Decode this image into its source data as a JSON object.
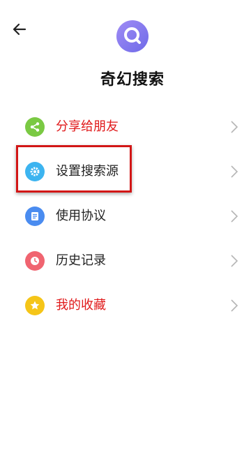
{
  "header": {
    "back_icon": "arrow-left-icon",
    "logo_icon": "magnifier-logo-icon",
    "title": "奇幻搜索"
  },
  "menu": {
    "items": [
      {
        "label": "分享给朋友",
        "icon": "share-icon",
        "icon_color": "#7ac943",
        "label_color": "#e0191a"
      },
      {
        "label": "设置搜索源",
        "icon": "gear-icon",
        "icon_color": "#3cb4f0",
        "label_color": "#222222"
      },
      {
        "label": "使用协议",
        "icon": "document-icon",
        "icon_color": "#4a8cf0",
        "label_color": "#222222"
      },
      {
        "label": "历史记录",
        "icon": "clock-icon",
        "icon_color": "#f06470",
        "label_color": "#222222"
      },
      {
        "label": "我的收藏",
        "icon": "star-icon",
        "icon_color": "#f5c518",
        "label_color": "#e0191a"
      }
    ]
  },
  "colors": {
    "accent_red": "#e0191a",
    "highlight_border": "#d21616",
    "logo_purple": "#8a7cf0"
  }
}
